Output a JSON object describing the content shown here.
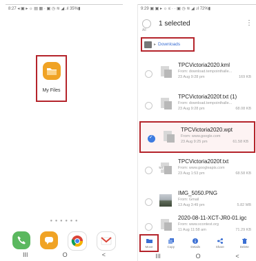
{
  "left_screen": {
    "status_bar": "8:27 ◂ ▣ ▸ ☼ ▤ ▦ · ▣ ◷ ≋ ◢ .ıl 35%▮",
    "app": {
      "label": "My Files",
      "icon": "folder-icon",
      "color": "#f0a325"
    },
    "page_dots": "● ● ● ● ● ●",
    "dock": [
      {
        "icon": "phone-icon",
        "color": "#5bb85f"
      },
      {
        "icon": "messages-icon",
        "color": "#f0a325"
      },
      {
        "icon": "chrome-icon",
        "color": "#ffffff"
      },
      {
        "icon": "gmail-icon",
        "color": "#ffffff"
      }
    ],
    "nav": {
      "recents": "III",
      "home": "O",
      "back": "<"
    }
  },
  "right_screen": {
    "status_bar": "9:29 ▣ ▣ ▸ ☼ ≤ · · ▣ ◷ ≋ ◢ .ıl 72%▮",
    "selection": {
      "count_text": "1 selected",
      "all_label": "All"
    },
    "breadcrumb": {
      "label": "Downloads"
    },
    "files": [
      {
        "name": "TPCVictoria2020.kml",
        "source": "From: download.tempointhalle...",
        "date": "23 Aug 9:28 pm",
        "size": "169 KB",
        "selected": false,
        "thumb": "doc"
      },
      {
        "name": "TPCVictoria2020f.txt (1)",
        "source": "From: download.tempointhalle...",
        "date": "23 Aug 9:28 pm",
        "size": "68.08 KB",
        "selected": false,
        "thumb": "doc"
      },
      {
        "name": "TPCVictoria2020.wpt",
        "source": "From: www.google.com",
        "date": "23 Aug 9:25 pm",
        "size": "61.58 KB",
        "selected": true,
        "thumb": "doc"
      },
      {
        "name": "TPCVictoria2020f.txt",
        "source": "From: www.googleapis.com",
        "date": "23 Aug 1:53 pm",
        "size": "68.58 KB",
        "selected": false,
        "thumb": "txt",
        "thumb_tag": "TXT"
      },
      {
        "name": "IMG_5050.PNG",
        "source": "From: Gmail",
        "date": "13 Aug 3:49 pm",
        "size": "5.82 MB",
        "selected": false,
        "thumb": "photo"
      },
      {
        "name": "2020-08-11-XCT-JR0-01.igc",
        "source": "From: www.xcontest.org",
        "date": "11 Aug 11:58 am",
        "size": "71.29 KB",
        "selected": false,
        "thumb": "doc"
      }
    ],
    "actions": [
      {
        "label": "Move",
        "icon": "move-icon"
      },
      {
        "label": "Copy",
        "icon": "copy-icon"
      },
      {
        "label": "Details",
        "icon": "info-icon"
      },
      {
        "label": "Share",
        "icon": "share-icon"
      },
      {
        "label": "Delete",
        "icon": "trash-icon"
      }
    ],
    "nav": {
      "recents": "III",
      "home": "O",
      "back": "<"
    },
    "accent": "#3b6fd3",
    "highlight": "#b4232a"
  }
}
